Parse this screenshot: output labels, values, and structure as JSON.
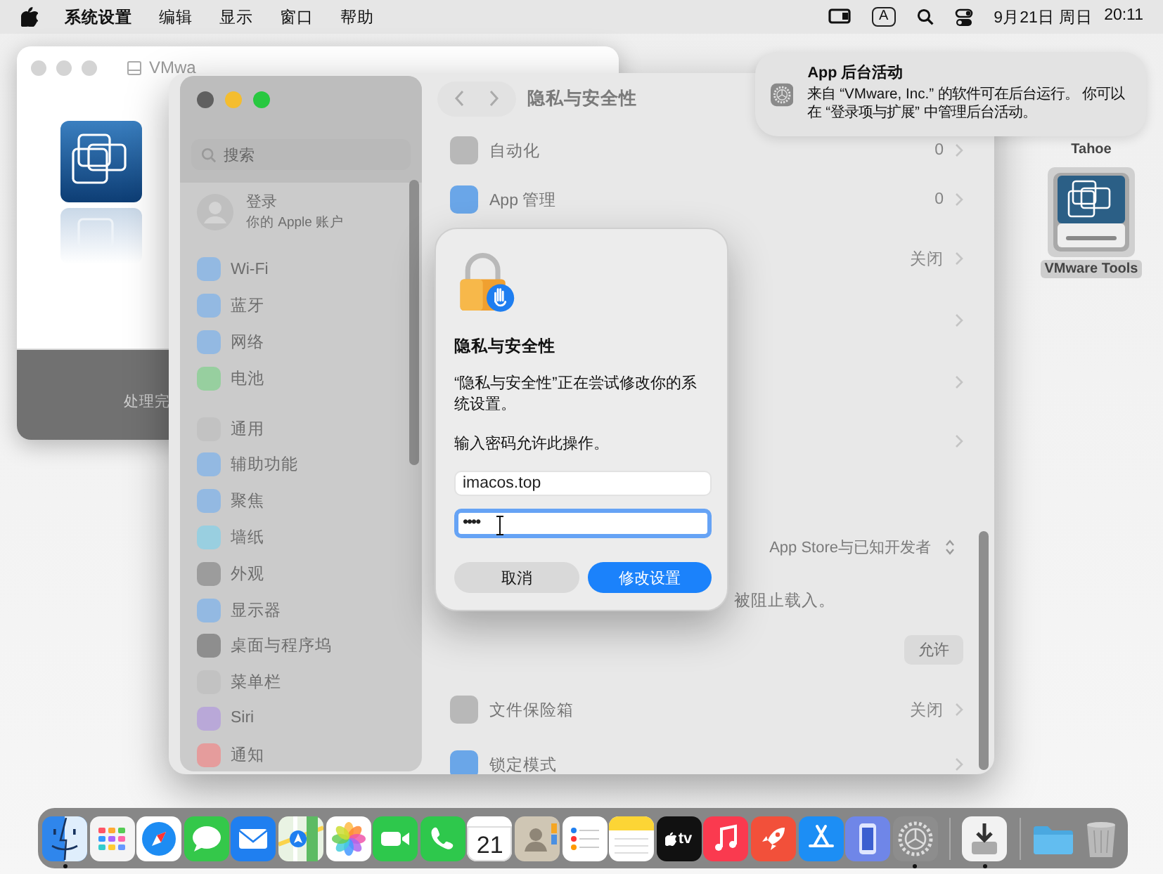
{
  "menu_bar": {
    "app_name": "系统设置",
    "menus": [
      "编辑",
      "显示",
      "窗口",
      "帮助"
    ],
    "input_source": "A",
    "date": "9月21日 周日",
    "time": "20:11"
  },
  "background_window": {
    "title": "VMwa",
    "status": "处理完"
  },
  "settings_window": {
    "search": {
      "placeholder": "搜索"
    },
    "account": {
      "title": "登录",
      "subtitle": "你的 Apple 账户"
    },
    "sidebar": {
      "groups": [
        [
          {
            "label": "Wi-Fi",
            "color": "#93b9e2"
          },
          {
            "label": "蓝牙",
            "color": "#93b9e2"
          },
          {
            "label": "网络",
            "color": "#93b9e2"
          },
          {
            "label": "电池",
            "color": "#97cf9f"
          }
        ],
        [
          {
            "label": "通用",
            "color": "#c2c2c2"
          },
          {
            "label": "辅助功能",
            "color": "#93b9e2"
          },
          {
            "label": "聚焦",
            "color": "#93b9e2"
          },
          {
            "label": "墙纸",
            "color": "#99cfe0"
          },
          {
            "label": "外观",
            "color": "#9c9c9c"
          },
          {
            "label": "显示器",
            "color": "#93b9e2"
          },
          {
            "label": "桌面与程序坞",
            "color": "#8e8e8e"
          },
          {
            "label": "菜单栏",
            "color": "#c2c2c2"
          },
          {
            "label": "Siri",
            "color": "#b9a8d8"
          },
          {
            "label": "通知",
            "color": "#e59c9c"
          }
        ]
      ]
    },
    "title": "隐私与安全性",
    "rows": [
      {
        "kind": "link",
        "label": "自动化",
        "value": "0",
        "color": "#b8b8b8"
      },
      {
        "kind": "link",
        "label": "App 管理",
        "value": "0",
        "color": "#6aa6e8"
      },
      {
        "kind": "link",
        "value": "关闭"
      },
      {
        "kind": "link"
      },
      {
        "kind": "link"
      },
      {
        "kind": "link"
      },
      {
        "kind": "popup",
        "value": "App Store与已知开发者"
      },
      {
        "kind": "note",
        "text": "被阻止载入。"
      },
      {
        "kind": "button",
        "label": "允许"
      },
      {
        "kind": "link",
        "label": "文件保险箱",
        "value": "关闭",
        "color": "#b8b8b8"
      },
      {
        "kind": "link",
        "label": "锁定模式",
        "color": "#6aa6e8"
      }
    ]
  },
  "auth_dialog": {
    "title": "隐私与安全性",
    "message": "“隐私与安全性”正在尝试修改你的系统设置。",
    "prompt": "输入密码允许此操作。",
    "fields": [
      {
        "kind": "username",
        "value": "imacos.top",
        "focused": false
      },
      {
        "kind": "password",
        "value": "••••",
        "focused": true
      }
    ],
    "buttons": [
      {
        "label": "取消",
        "default": false
      },
      {
        "label": "修改设置",
        "default": true
      }
    ]
  },
  "notification": {
    "title": "App 后台活动",
    "body": "来自 “VMware, Inc.” 的软件可在后台运行。 你可以在 “登录项与扩展” 中管理后台活动。"
  },
  "desktop_icons": [
    {
      "kind": "hidden",
      "label": "Tahoe",
      "selected": false
    },
    {
      "kind": "disk",
      "label": "VMware Tools",
      "selected": true
    }
  ],
  "dock": {
    "items": [
      {
        "kind": "finder",
        "running": true
      },
      {
        "kind": "launchpad",
        "running": false
      },
      {
        "kind": "safari",
        "running": false
      },
      {
        "kind": "messages",
        "running": false
      },
      {
        "kind": "mail",
        "running": false
      },
      {
        "kind": "maps",
        "running": false
      },
      {
        "kind": "photos",
        "running": false
      },
      {
        "kind": "facetime",
        "running": false
      },
      {
        "kind": "phone",
        "running": false
      },
      {
        "kind": "calendar",
        "text": "21",
        "running": false
      },
      {
        "kind": "contacts",
        "running": false
      },
      {
        "kind": "reminders",
        "running": false
      },
      {
        "kind": "notes",
        "running": false
      },
      {
        "kind": "tv",
        "text": "tv",
        "running": false
      },
      {
        "kind": "music",
        "running": false
      },
      {
        "kind": "rocket",
        "running": false
      },
      {
        "kind": "appstore",
        "running": false
      },
      {
        "kind": "mirroring",
        "running": false
      },
      {
        "kind": "settings",
        "running": true
      },
      {
        "kind": "separator"
      },
      {
        "kind": "installer",
        "running": true
      },
      {
        "kind": "separator"
      },
      {
        "kind": "folder",
        "running": false
      },
      {
        "kind": "trash",
        "running": false
      }
    ]
  }
}
